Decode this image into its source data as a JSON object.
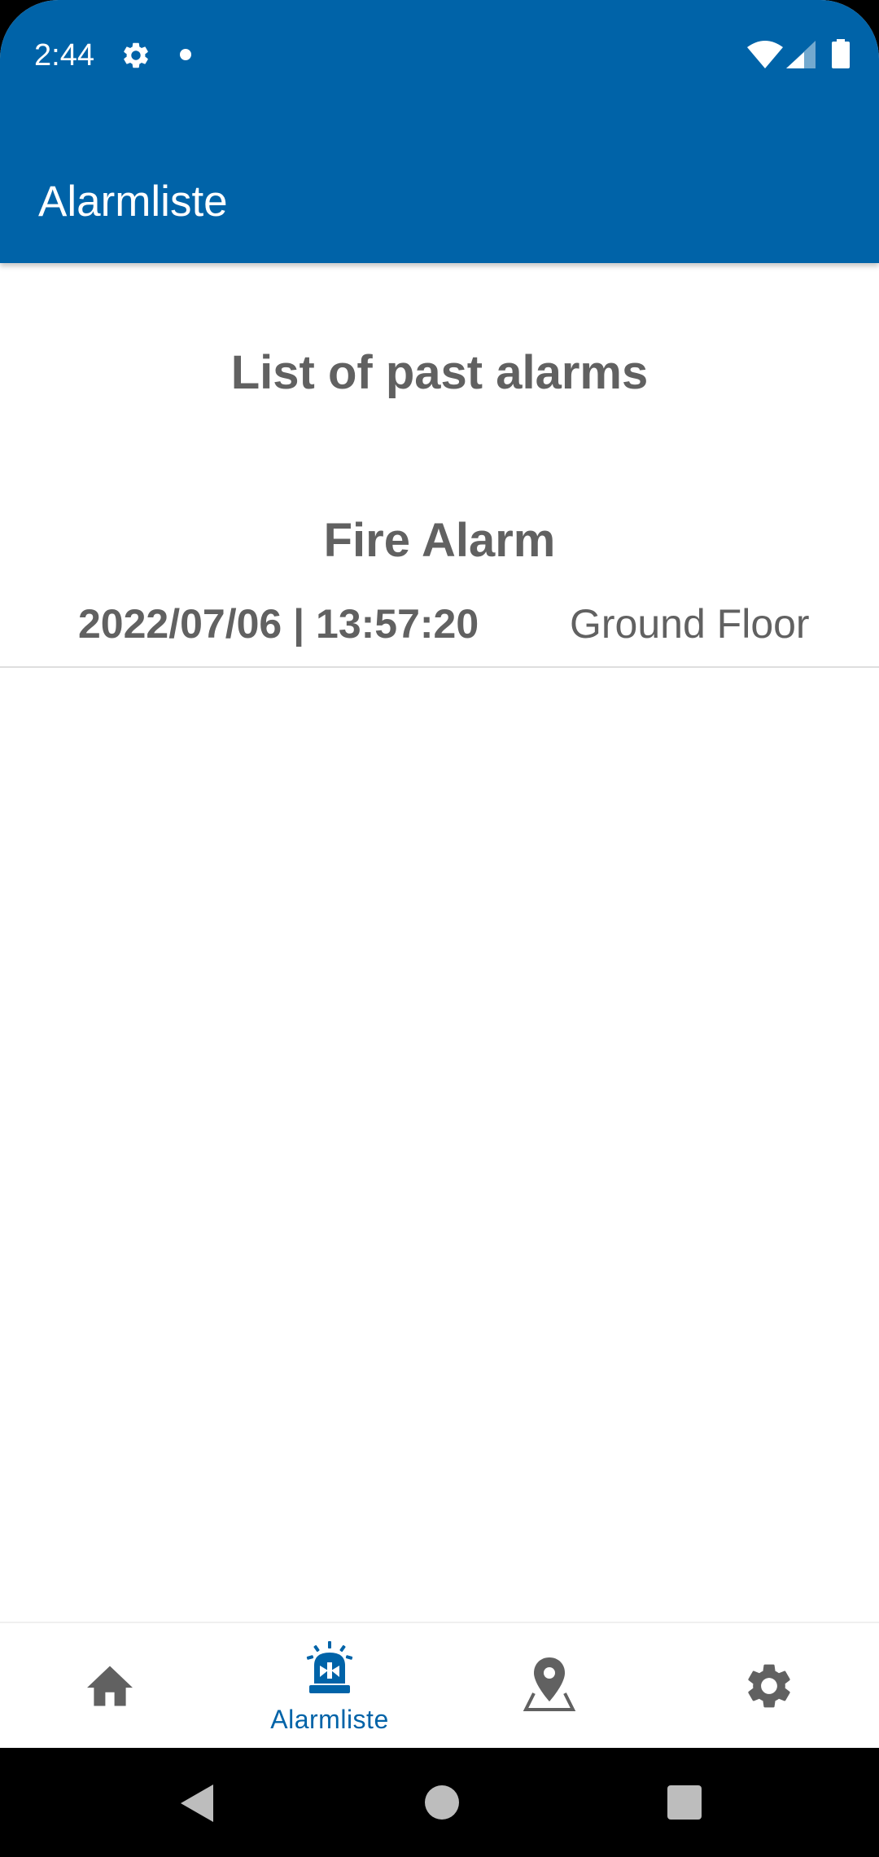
{
  "status_bar": {
    "time": "2:44",
    "icons": [
      "gear-icon",
      "notification-dot-icon",
      "wifi-icon",
      "signal-icon",
      "battery-icon"
    ]
  },
  "app_bar": {
    "title": "Alarmliste",
    "color": "#0063A8"
  },
  "page": {
    "heading": "List of past alarms"
  },
  "alarms": [
    {
      "title": "Fire Alarm",
      "datetime": "2022/07/06 | 13:57:20",
      "location": "Ground Floor"
    }
  ],
  "bottom_nav": {
    "items": [
      {
        "icon": "home-icon",
        "label": "",
        "active": false
      },
      {
        "icon": "siren-icon",
        "label": "Alarmliste",
        "active": true
      },
      {
        "icon": "map-pin-icon",
        "label": "",
        "active": false
      },
      {
        "icon": "settings-gear-icon",
        "label": "",
        "active": false
      }
    ],
    "active_color": "#0063A8",
    "inactive_color": "#616161"
  },
  "system_nav": {
    "icons": [
      "back-icon",
      "home-circle-icon",
      "recents-icon"
    ]
  }
}
